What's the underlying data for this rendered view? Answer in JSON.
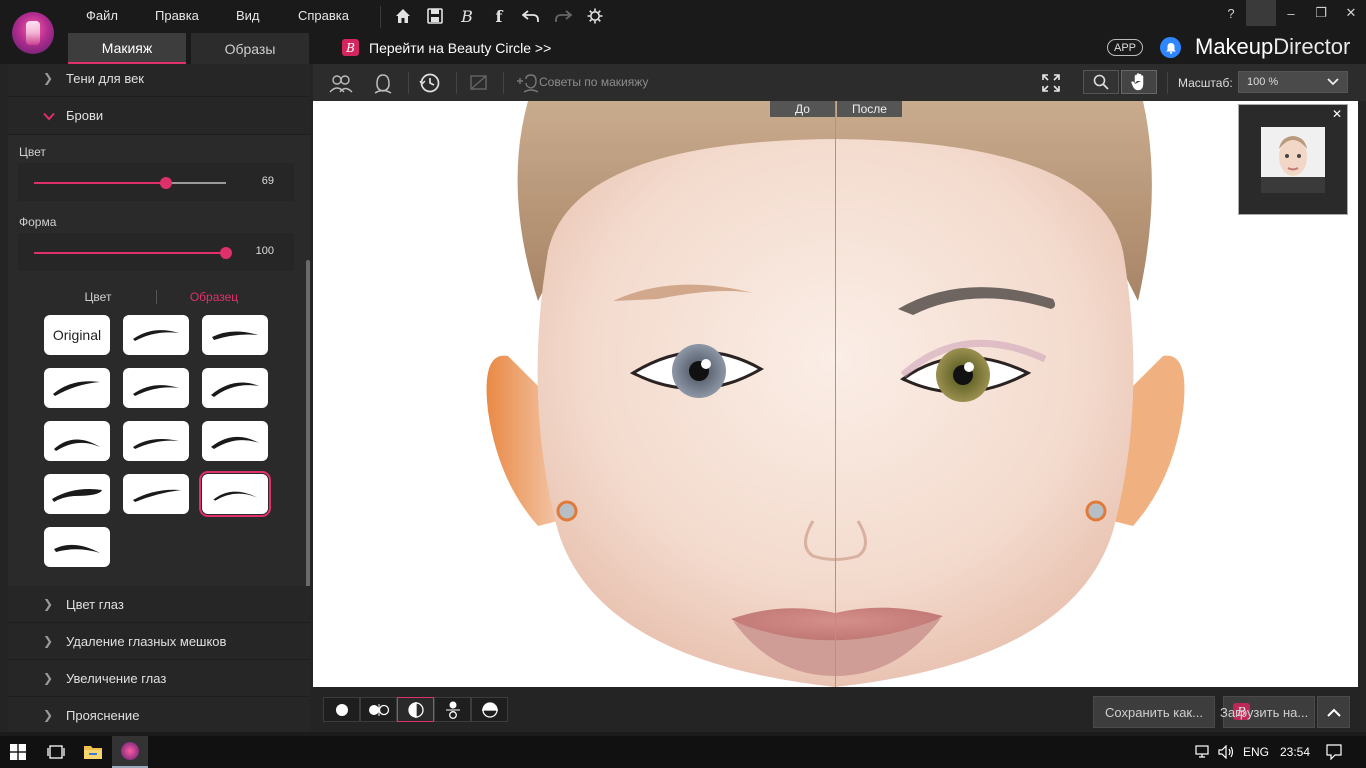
{
  "menu": [
    "Файл",
    "Правка",
    "Вид",
    "Справка"
  ],
  "tabs": [
    {
      "label": "Макияж",
      "active": true
    },
    {
      "label": "Образы",
      "active": false
    }
  ],
  "beauty_circle": {
    "badge": "B",
    "label": "Перейти на Beauty Circle >>"
  },
  "app_badge": "APP",
  "brand": {
    "bold": "Makeup",
    "rest": "Director"
  },
  "window_controls": [
    "?",
    "–",
    "❐",
    "✕"
  ],
  "panel": {
    "top_section": "Тени для век",
    "open_section": "Брови",
    "color_slider": {
      "label": "Цвет",
      "value": "69",
      "fraction": 0.69
    },
    "shape_slider": {
      "label": "Форма",
      "value": "100",
      "fraction": 1.0
    },
    "segments": [
      {
        "label": "Цвет",
        "active": false
      },
      {
        "label": "Образец",
        "active": true
      }
    ],
    "original_label": "Original",
    "selected_swatch": 11,
    "bottom_sections": [
      "Цвет глаз",
      "Удаление глазных мешков",
      "Увеличение глаз",
      "Прояснение"
    ]
  },
  "canvas_toolbar": {
    "tips": "Советы по макияжу",
    "scale_label": "Масштаб:",
    "scale_value": "100 %"
  },
  "canvas": {
    "before": "До",
    "after": "После"
  },
  "bottom": {
    "save_as": "Сохранить как...",
    "upload": "Загрузить на..."
  },
  "taskbar": {
    "lang": "ENG",
    "time": "23:54"
  },
  "colors": {
    "accent": "#e0306b",
    "bell": "#2f86ff"
  }
}
